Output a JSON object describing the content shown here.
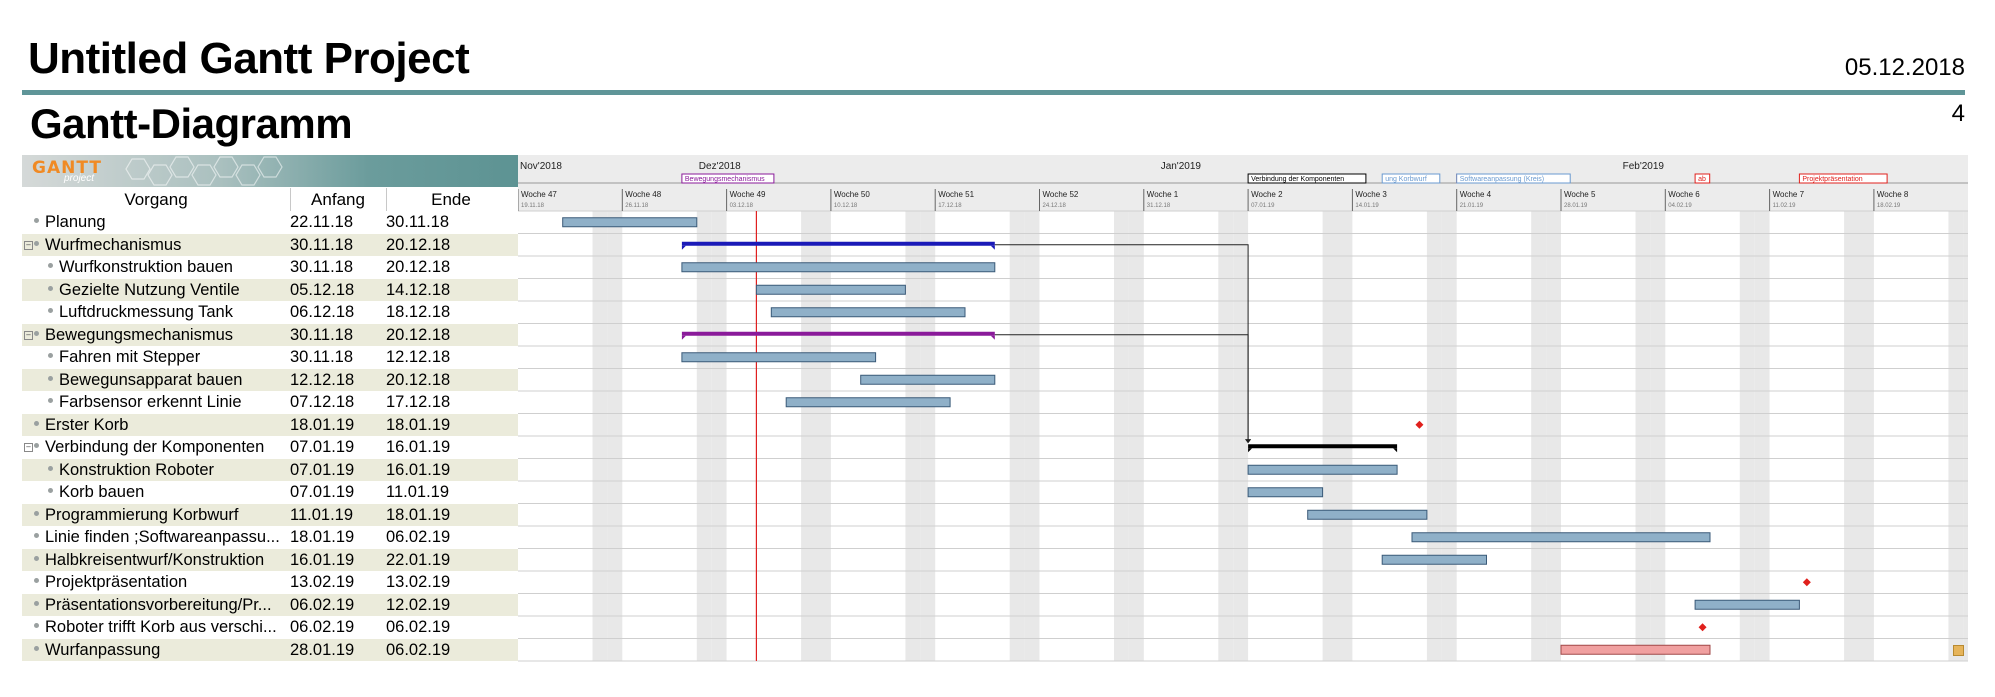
{
  "header": {
    "title": "Untitled Gantt Project",
    "date": "05.12.2018",
    "subtitle": "Gantt-Diagramm",
    "page": "4"
  },
  "logo": {
    "text": "GANTT",
    "sub": "project"
  },
  "columns": {
    "name": "Vorgang",
    "start": "Anfang",
    "end": "Ende"
  },
  "colors": {
    "task_bar": "#8fb0c8",
    "task_bar_border": "#3a5a78",
    "wurf_summary": "#1a1ab8",
    "bewegung_summary": "#8a1a9a",
    "summary_black": "#000000",
    "milestone": "#e0201c",
    "today_line": "#e02020",
    "wurfanpassung": "#f0a0a0",
    "weekend": "#e8e8e8"
  },
  "timeline": {
    "months": [
      {
        "label": "Nov'2018",
        "x_date": "2018-11-19"
      },
      {
        "label": "Dez'2018",
        "x_date": "2018-12-01"
      },
      {
        "label": "Jan'2019",
        "x_date": "2019-01-01"
      },
      {
        "label": "Feb'2019",
        "x_date": "2019-02-01"
      }
    ],
    "weeks": [
      {
        "label": "Woche 47",
        "date": "19.11.18"
      },
      {
        "label": "Woche 48",
        "date": "26.11.18"
      },
      {
        "label": "Woche 49",
        "date": "03.12.18"
      },
      {
        "label": "Woche 50",
        "date": "10.12.18"
      },
      {
        "label": "Woche 51",
        "date": "17.12.18"
      },
      {
        "label": "Woche 52",
        "date": "24.12.18"
      },
      {
        "label": "Woche 1",
        "date": "31.12.18"
      },
      {
        "label": "Woche 2",
        "date": "07.01.19"
      },
      {
        "label": "Woche 3",
        "date": "14.01.19"
      },
      {
        "label": "Woche 4",
        "date": "21.01.19"
      },
      {
        "label": "Woche 5",
        "date": "28.01.19"
      },
      {
        "label": "Woche 6",
        "date": "04.02.19"
      },
      {
        "label": "Woche 7",
        "date": "11.02.19"
      },
      {
        "label": "Woche 8",
        "date": "18.02.19"
      }
    ],
    "labels": [
      {
        "text": "Bewegungsmechanismus",
        "date": "2018-11-30",
        "color": "#8a1a9a"
      },
      {
        "text": "Verbindung der Komponenten",
        "date": "2019-01-07",
        "color": "#000000"
      },
      {
        "text": "ung Korbwurf",
        "date": "2019-01-16",
        "color": "#6a9ad0"
      },
      {
        "text": "Erster Korb",
        "date": "2019-01-21",
        "color": "#e0201c"
      },
      {
        "text": "Softwareanpassung (Kreis)",
        "date": "2019-01-21",
        "color": "#6a9ad0"
      },
      {
        "text": "ab",
        "date": "2019-02-06",
        "color": "#e0201c"
      },
      {
        "text": "Projektpräsentation",
        "date": "2019-02-13",
        "color": "#e0201c"
      }
    ]
  },
  "chart_data": {
    "type": "gantt",
    "today": "2018-12-05",
    "tasks": [
      {
        "name": "Planung",
        "start": "22.11.18",
        "end": "30.11.18",
        "kind": "task",
        "level": 0
      },
      {
        "name": "Wurfmechanismus",
        "start": "30.11.18",
        "end": "20.12.18",
        "kind": "summary",
        "level": 0,
        "color": "#1a1ab8"
      },
      {
        "name": "Wurfkonstruktion bauen",
        "start": "30.11.18",
        "end": "20.12.18",
        "kind": "task",
        "level": 1
      },
      {
        "name": "Gezielte Nutzung Ventile",
        "start": "05.12.18",
        "end": "14.12.18",
        "kind": "task",
        "level": 1
      },
      {
        "name": "Luftdruckmessung Tank",
        "start": "06.12.18",
        "end": "18.12.18",
        "kind": "task",
        "level": 1
      },
      {
        "name": "Bewegungsmechanismus",
        "start": "30.11.18",
        "end": "20.12.18",
        "kind": "summary",
        "level": 0,
        "color": "#8a1a9a"
      },
      {
        "name": "Fahren mit Stepper",
        "start": "30.11.18",
        "end": "12.12.18",
        "kind": "task",
        "level": 1
      },
      {
        "name": "Bewegunsapparat bauen",
        "start": "12.12.18",
        "end": "20.12.18",
        "kind": "task",
        "level": 1
      },
      {
        "name": "Farbsensor erkennt Linie",
        "start": "07.12.18",
        "end": "17.12.18",
        "kind": "task",
        "level": 1
      },
      {
        "name": "Erster Korb",
        "start": "18.01.19",
        "end": "18.01.19",
        "kind": "milestone",
        "level": 0
      },
      {
        "name": "Verbindung der Komponenten",
        "start": "07.01.19",
        "end": "16.01.19",
        "kind": "summary",
        "level": 0,
        "color": "#000000"
      },
      {
        "name": "Konstruktion Roboter",
        "start": "07.01.19",
        "end": "16.01.19",
        "kind": "task",
        "level": 1
      },
      {
        "name": "Korb bauen",
        "start": "07.01.19",
        "end": "11.01.19",
        "kind": "task",
        "level": 1
      },
      {
        "name": "Programmierung Korbwurf",
        "start": "11.01.19",
        "end": "18.01.19",
        "kind": "task",
        "level": 0
      },
      {
        "name": "Linie finden ;Softwareanpassu...",
        "start": "18.01.19",
        "end": "06.02.19",
        "kind": "task",
        "level": 0
      },
      {
        "name": "Halbkreisentwurf/Konstruktion",
        "start": "16.01.19",
        "end": "22.01.19",
        "kind": "task",
        "level": 0
      },
      {
        "name": "Projektpräsentation",
        "start": "13.02.19",
        "end": "13.02.19",
        "kind": "milestone",
        "level": 0
      },
      {
        "name": "Präsentationsvorbereitung/Pr...",
        "start": "06.02.19",
        "end": "12.02.19",
        "kind": "task",
        "level": 0
      },
      {
        "name": "Roboter trifft Korb aus verschi...",
        "start": "06.02.19",
        "end": "06.02.19",
        "kind": "milestone",
        "level": 0
      },
      {
        "name": "Wurfanpassung",
        "start": "28.01.19",
        "end": "06.02.19",
        "kind": "task",
        "level": 0,
        "color": "#f0a0a0"
      }
    ],
    "dependencies": [
      {
        "from": 1,
        "to": 10
      },
      {
        "from": 5,
        "to": 10
      }
    ]
  }
}
